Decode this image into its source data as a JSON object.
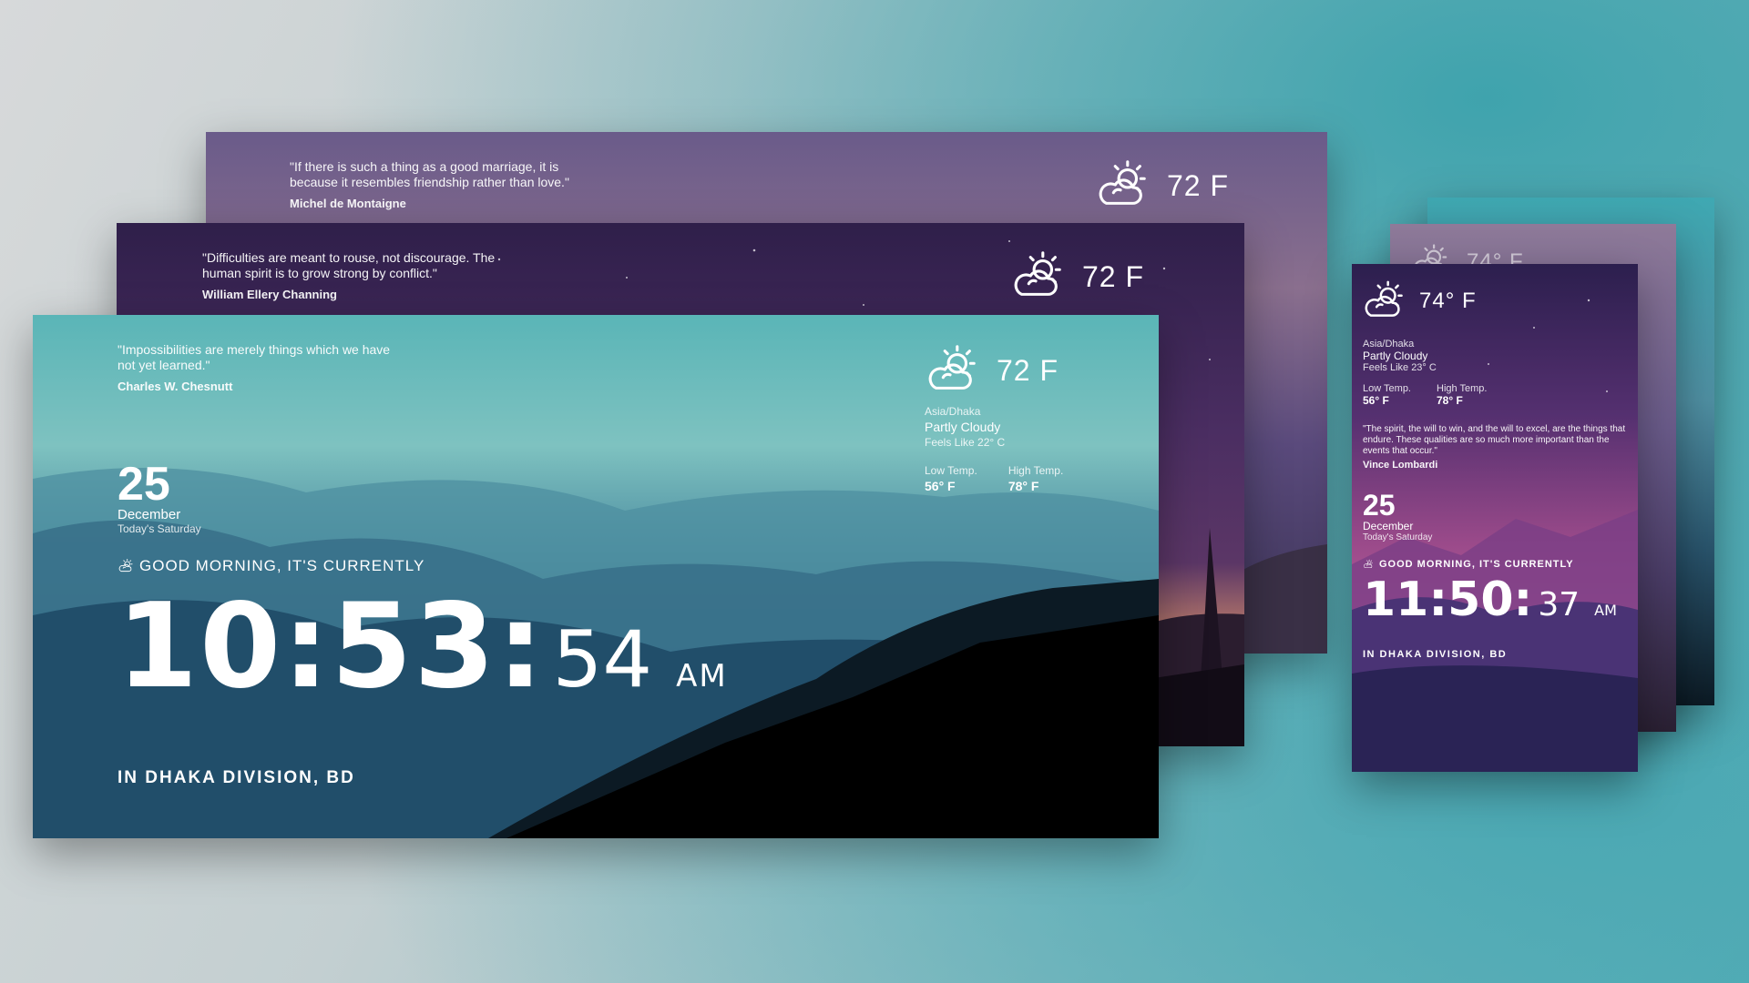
{
  "cards": {
    "back": {
      "quote": "\"If there is such a thing as a good marriage, it is because it resembles friendship rather than love.\"",
      "author": "Michel de Montaigne",
      "temp": "72 F"
    },
    "middle": {
      "quote": "\"Difficulties are meant to rouse, not discourage. The human spirit is to grow strong by conflict.\"",
      "author": "William Ellery Channing",
      "temp": "72 F"
    },
    "front": {
      "quote": "\"Impossibilities are merely things which we have not yet learned.\"",
      "author": "Charles W. Chesnutt",
      "temp": "72 F",
      "timezone": "Asia/Dhaka",
      "condition": "Partly Cloudy",
      "feels": "Feels Like 22° C",
      "low_label": "Low Temp.",
      "low_value": "56° F",
      "high_label": "High Temp.",
      "high_value": "78° F",
      "day": "25",
      "month": "December",
      "weekday": "Today's Saturday",
      "greeting": "GOOD MORNING, IT'S CURRENTLY",
      "hours_minutes": "10:53:",
      "seconds": "54",
      "ampm": "AM",
      "location": "IN DHAKA DIVISION, BD"
    },
    "mobile": {
      "temp": "74° F",
      "timezone": "Asia/Dhaka",
      "condition": "Partly Cloudy",
      "feels": "Feels Like 23° C",
      "low_label": "Low Temp.",
      "low_value": "56° F",
      "high_label": "High Temp.",
      "high_value": "78° F",
      "quote": "\"The spirit, the will to win, and the will to excel, are the things that endure. These qualities are so much more important than the events that occur.\"",
      "author": "Vince Lombardi",
      "day": "25",
      "month": "December",
      "weekday": "Today's Saturday",
      "greeting": "GOOD MORNING, IT'S CURRENTLY",
      "hours_minutes": "11:50:",
      "seconds": "37",
      "ampm": "AM",
      "location": "IN DHAKA DIVISION, BD"
    },
    "mobile_back": {
      "temp": "74° F"
    }
  },
  "icons": {
    "weather": "partly-cloudy-icon",
    "greeting": "sun-cloud-icon"
  },
  "colors": {
    "teal_sky": "#5fb3b6",
    "purple_sky": "#3a2558",
    "sunset": "#e0a27c"
  }
}
